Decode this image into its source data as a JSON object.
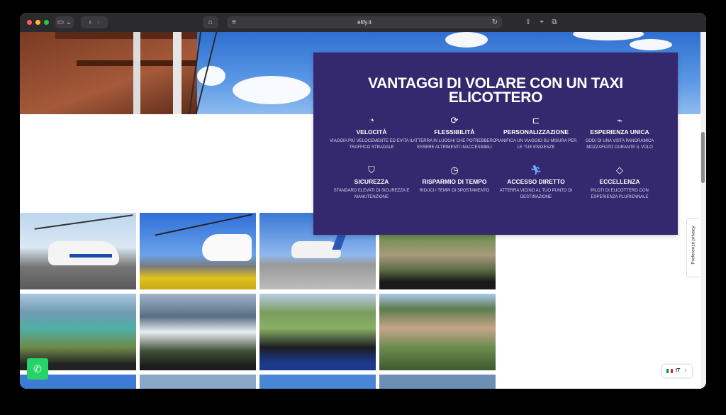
{
  "browser": {
    "url": "elify.it",
    "icons": [
      "sidebar-icon",
      "back-icon",
      "forward-icon",
      "home-icon",
      "reader-icon",
      "reload-icon",
      "share-icon",
      "new-tab-icon",
      "tabs-icon"
    ]
  },
  "panel": {
    "title": "VANTAGGI DI VOLARE CON UN TAXI ELICOTTERO",
    "background": "#34296e",
    "features": [
      {
        "title": "VELOCITÀ",
        "desc": "VIAGGIA PIÙ VELOCEMENTE ED EVITA IL TRAFFICO STRADALE",
        "icon": "speedometer-icon"
      },
      {
        "title": "FLESSIBILITÀ",
        "desc": "ATTERRA IN LUOGHI CHE POTREBBERO ESSERE ALTRIMENTI INACCESSIBILI",
        "icon": "refresh-icon"
      },
      {
        "title": "PERSONALIZZAZIONE",
        "desc": "PIANIFICA UN VIAGGIO SU MISURA PER LE TUE ESIGENZE",
        "icon": "megaphone-icon"
      },
      {
        "title": "ESPERIENZA UNICA",
        "desc": "GODI DI UNA VISTA PANORAMICA MOZZAFIATO DURANTE IL VOLO",
        "icon": "helicopter-icon"
      },
      {
        "title": "SICUREZZA",
        "desc": "STANDARD ELEVATI DI SICUREZZA E MANUTENZIONE",
        "icon": "shield-check-icon"
      },
      {
        "title": "RISPARMIO DI TEMPO",
        "desc": "RIDUCI I TEMPI DI SPOSTAMENTO",
        "icon": "user-clock-icon"
      },
      {
        "title": "ACCESSO DIRETTO",
        "desc": "ATTERRA VICINO AL TUO PUNTO DI DESTINAZIONE",
        "icon": "running-person-icon"
      },
      {
        "title": "ECCELLENZA",
        "desc": "PILOTI DI ELICOTTERO CON ESPERIENZA PLURIENNALE",
        "icon": "diamond-icon"
      }
    ]
  },
  "privacy": {
    "label": "Preferenze privacy"
  },
  "language": {
    "code": "IT",
    "flag": "italy-flag-icon"
  },
  "whatsapp": {
    "icon": "whatsapp-icon"
  }
}
